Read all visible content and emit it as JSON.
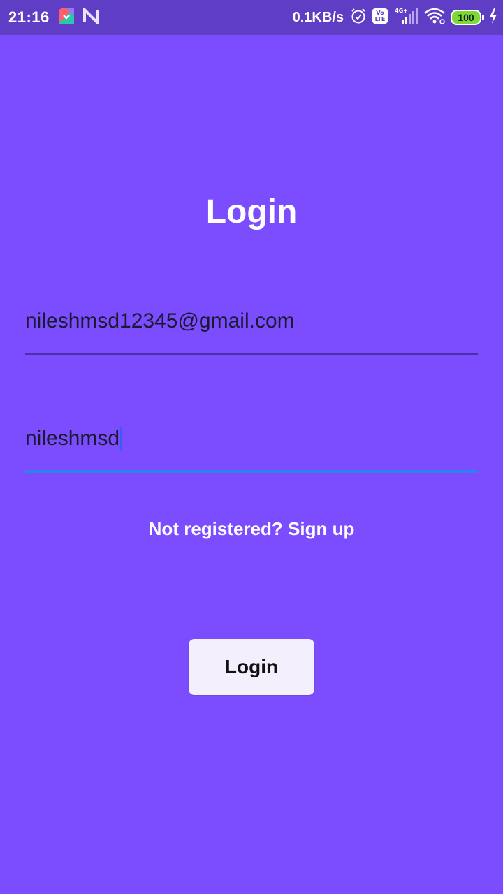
{
  "status_bar": {
    "time": "21:16",
    "net_speed": "0.1KB/s",
    "network_type": "4G+",
    "volte": "Vo LTE",
    "battery_level": "100",
    "icons": [
      "app-notification-icon",
      "n-notification-icon",
      "alarm-icon",
      "volte-icon",
      "signal-icon",
      "wifi-icon",
      "battery-icon",
      "charging-icon"
    ]
  },
  "login": {
    "title": "Login",
    "email_value": "nileshmsd12345@gmail.com",
    "password_value": "nileshmsd",
    "signup_text": "Not registered? Sign up",
    "button_label": "Login"
  },
  "colors": {
    "background": "#7c4dff",
    "status_bar": "#5f3dc4",
    "focus_underline": "#2f7ff0",
    "button_bg": "#f3effc"
  }
}
